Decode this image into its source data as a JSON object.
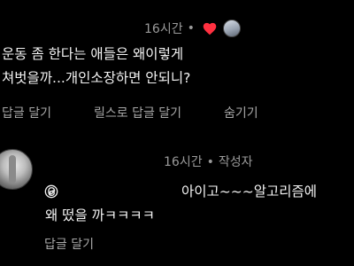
{
  "comment1": {
    "time": "16시간",
    "separator": "•",
    "lines": [
      "운동 좀 한다는 애들은 왜이렇게",
      "쳐벗을까...개인소장하면 안되니?"
    ],
    "actions": [
      "답글 달기",
      "릴스로 답글 달기",
      "숨기기"
    ],
    "liked": true,
    "heart_color": "#ff3040"
  },
  "comment2": {
    "time": "16시간",
    "separator": "•",
    "author_badge": "작성자",
    "lines": [
      "아이고~~~알고리즘에",
      "왜 떴을 까ㅋㅋㅋㅋ"
    ],
    "actions": [
      "답글 달기"
    ],
    "icon": "threads-icon"
  }
}
